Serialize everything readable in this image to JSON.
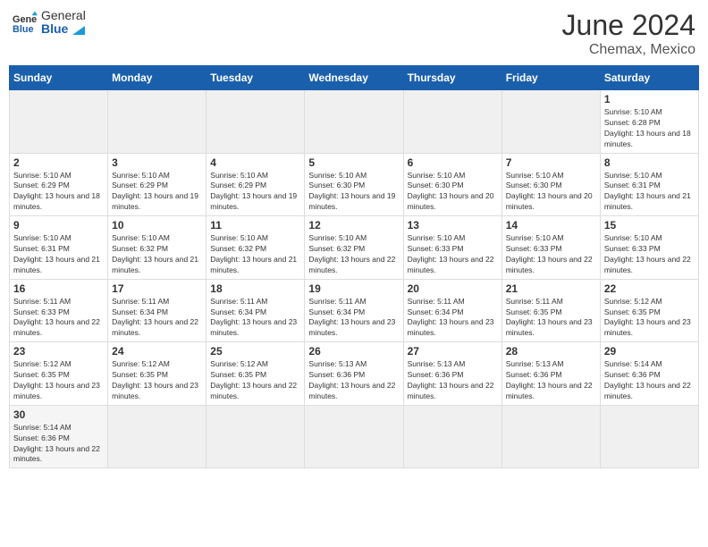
{
  "logo": {
    "text_general": "General",
    "text_blue": "Blue"
  },
  "title": "June 2024",
  "location": "Chemax, Mexico",
  "days_of_week": [
    "Sunday",
    "Monday",
    "Tuesday",
    "Wednesday",
    "Thursday",
    "Friday",
    "Saturday"
  ],
  "weeks": [
    [
      {
        "day": null,
        "empty": true
      },
      {
        "day": null,
        "empty": true
      },
      {
        "day": null,
        "empty": true
      },
      {
        "day": null,
        "empty": true
      },
      {
        "day": null,
        "empty": true
      },
      {
        "day": null,
        "empty": true
      },
      {
        "day": "1",
        "sunrise": "5:10 AM",
        "sunset": "6:28 PM",
        "daylight": "13 hours and 18 minutes."
      }
    ],
    [
      {
        "day": "2",
        "sunrise": "5:10 AM",
        "sunset": "6:29 PM",
        "daylight": "13 hours and 18 minutes."
      },
      {
        "day": "3",
        "sunrise": "5:10 AM",
        "sunset": "6:29 PM",
        "daylight": "13 hours and 19 minutes."
      },
      {
        "day": "4",
        "sunrise": "5:10 AM",
        "sunset": "6:29 PM",
        "daylight": "13 hours and 19 minutes."
      },
      {
        "day": "5",
        "sunrise": "5:10 AM",
        "sunset": "6:30 PM",
        "daylight": "13 hours and 19 minutes."
      },
      {
        "day": "6",
        "sunrise": "5:10 AM",
        "sunset": "6:30 PM",
        "daylight": "13 hours and 20 minutes."
      },
      {
        "day": "7",
        "sunrise": "5:10 AM",
        "sunset": "6:30 PM",
        "daylight": "13 hours and 20 minutes."
      },
      {
        "day": "8",
        "sunrise": "5:10 AM",
        "sunset": "6:31 PM",
        "daylight": "13 hours and 21 minutes."
      }
    ],
    [
      {
        "day": "9",
        "sunrise": "5:10 AM",
        "sunset": "6:31 PM",
        "daylight": "13 hours and 21 minutes."
      },
      {
        "day": "10",
        "sunrise": "5:10 AM",
        "sunset": "6:32 PM",
        "daylight": "13 hours and 21 minutes."
      },
      {
        "day": "11",
        "sunrise": "5:10 AM",
        "sunset": "6:32 PM",
        "daylight": "13 hours and 21 minutes."
      },
      {
        "day": "12",
        "sunrise": "5:10 AM",
        "sunset": "6:32 PM",
        "daylight": "13 hours and 22 minutes."
      },
      {
        "day": "13",
        "sunrise": "5:10 AM",
        "sunset": "6:33 PM",
        "daylight": "13 hours and 22 minutes."
      },
      {
        "day": "14",
        "sunrise": "5:10 AM",
        "sunset": "6:33 PM",
        "daylight": "13 hours and 22 minutes."
      },
      {
        "day": "15",
        "sunrise": "5:10 AM",
        "sunset": "6:33 PM",
        "daylight": "13 hours and 22 minutes."
      }
    ],
    [
      {
        "day": "16",
        "sunrise": "5:11 AM",
        "sunset": "6:33 PM",
        "daylight": "13 hours and 22 minutes."
      },
      {
        "day": "17",
        "sunrise": "5:11 AM",
        "sunset": "6:34 PM",
        "daylight": "13 hours and 22 minutes."
      },
      {
        "day": "18",
        "sunrise": "5:11 AM",
        "sunset": "6:34 PM",
        "daylight": "13 hours and 23 minutes."
      },
      {
        "day": "19",
        "sunrise": "5:11 AM",
        "sunset": "6:34 PM",
        "daylight": "13 hours and 23 minutes."
      },
      {
        "day": "20",
        "sunrise": "5:11 AM",
        "sunset": "6:34 PM",
        "daylight": "13 hours and 23 minutes."
      },
      {
        "day": "21",
        "sunrise": "5:11 AM",
        "sunset": "6:35 PM",
        "daylight": "13 hours and 23 minutes."
      },
      {
        "day": "22",
        "sunrise": "5:12 AM",
        "sunset": "6:35 PM",
        "daylight": "13 hours and 23 minutes."
      }
    ],
    [
      {
        "day": "23",
        "sunrise": "5:12 AM",
        "sunset": "6:35 PM",
        "daylight": "13 hours and 23 minutes."
      },
      {
        "day": "24",
        "sunrise": "5:12 AM",
        "sunset": "6:35 PM",
        "daylight": "13 hours and 23 minutes."
      },
      {
        "day": "25",
        "sunrise": "5:12 AM",
        "sunset": "6:35 PM",
        "daylight": "13 hours and 22 minutes."
      },
      {
        "day": "26",
        "sunrise": "5:13 AM",
        "sunset": "6:36 PM",
        "daylight": "13 hours and 22 minutes."
      },
      {
        "day": "27",
        "sunrise": "5:13 AM",
        "sunset": "6:36 PM",
        "daylight": "13 hours and 22 minutes."
      },
      {
        "day": "28",
        "sunrise": "5:13 AM",
        "sunset": "6:36 PM",
        "daylight": "13 hours and 22 minutes."
      },
      {
        "day": "29",
        "sunrise": "5:14 AM",
        "sunset": "6:36 PM",
        "daylight": "13 hours and 22 minutes."
      }
    ],
    [
      {
        "day": "30",
        "sunrise": "5:14 AM",
        "sunset": "6:36 PM",
        "daylight": "13 hours and 22 minutes."
      },
      {
        "day": null,
        "empty": true
      },
      {
        "day": null,
        "empty": true
      },
      {
        "day": null,
        "empty": true
      },
      {
        "day": null,
        "empty": true
      },
      {
        "day": null,
        "empty": true
      },
      {
        "day": null,
        "empty": true
      }
    ]
  ]
}
